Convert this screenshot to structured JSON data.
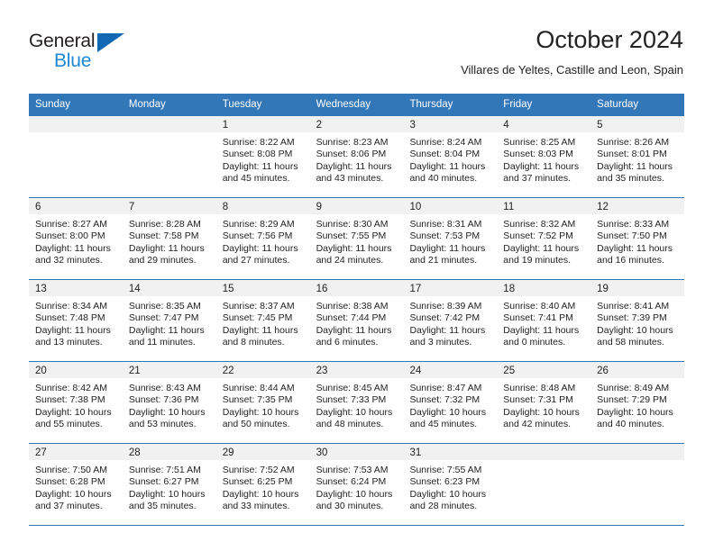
{
  "brand": {
    "name_part1": "General",
    "name_part2": "Blue",
    "triangle_color": "#1268b3",
    "blue_color": "#1b87d3"
  },
  "header": {
    "title": "October 2024",
    "subtitle": "Villares de Yeltes, Castille and Leon, Spain"
  },
  "theme": {
    "header_blue": "#3277b8",
    "daynum_band": "#f1f1f1",
    "text": "#222222"
  },
  "weekdays": [
    "Sunday",
    "Monday",
    "Tuesday",
    "Wednesday",
    "Thursday",
    "Friday",
    "Saturday"
  ],
  "weeks": [
    [
      {
        "day": "",
        "empty": true,
        "sunrise": "",
        "sunset": "",
        "daylight_line1": "",
        "daylight_line2": ""
      },
      {
        "day": "",
        "empty": true,
        "sunrise": "",
        "sunset": "",
        "daylight_line1": "",
        "daylight_line2": ""
      },
      {
        "day": "1",
        "sunrise": "Sunrise: 8:22 AM",
        "sunset": "Sunset: 8:08 PM",
        "daylight_line1": "Daylight: 11 hours",
        "daylight_line2": "and 45 minutes."
      },
      {
        "day": "2",
        "sunrise": "Sunrise: 8:23 AM",
        "sunset": "Sunset: 8:06 PM",
        "daylight_line1": "Daylight: 11 hours",
        "daylight_line2": "and 43 minutes."
      },
      {
        "day": "3",
        "sunrise": "Sunrise: 8:24 AM",
        "sunset": "Sunset: 8:04 PM",
        "daylight_line1": "Daylight: 11 hours",
        "daylight_line2": "and 40 minutes."
      },
      {
        "day": "4",
        "sunrise": "Sunrise: 8:25 AM",
        "sunset": "Sunset: 8:03 PM",
        "daylight_line1": "Daylight: 11 hours",
        "daylight_line2": "and 37 minutes."
      },
      {
        "day": "5",
        "sunrise": "Sunrise: 8:26 AM",
        "sunset": "Sunset: 8:01 PM",
        "daylight_line1": "Daylight: 11 hours",
        "daylight_line2": "and 35 minutes."
      }
    ],
    [
      {
        "day": "6",
        "sunrise": "Sunrise: 8:27 AM",
        "sunset": "Sunset: 8:00 PM",
        "daylight_line1": "Daylight: 11 hours",
        "daylight_line2": "and 32 minutes."
      },
      {
        "day": "7",
        "sunrise": "Sunrise: 8:28 AM",
        "sunset": "Sunset: 7:58 PM",
        "daylight_line1": "Daylight: 11 hours",
        "daylight_line2": "and 29 minutes."
      },
      {
        "day": "8",
        "sunrise": "Sunrise: 8:29 AM",
        "sunset": "Sunset: 7:56 PM",
        "daylight_line1": "Daylight: 11 hours",
        "daylight_line2": "and 27 minutes."
      },
      {
        "day": "9",
        "sunrise": "Sunrise: 8:30 AM",
        "sunset": "Sunset: 7:55 PM",
        "daylight_line1": "Daylight: 11 hours",
        "daylight_line2": "and 24 minutes."
      },
      {
        "day": "10",
        "sunrise": "Sunrise: 8:31 AM",
        "sunset": "Sunset: 7:53 PM",
        "daylight_line1": "Daylight: 11 hours",
        "daylight_line2": "and 21 minutes."
      },
      {
        "day": "11",
        "sunrise": "Sunrise: 8:32 AM",
        "sunset": "Sunset: 7:52 PM",
        "daylight_line1": "Daylight: 11 hours",
        "daylight_line2": "and 19 minutes."
      },
      {
        "day": "12",
        "sunrise": "Sunrise: 8:33 AM",
        "sunset": "Sunset: 7:50 PM",
        "daylight_line1": "Daylight: 11 hours",
        "daylight_line2": "and 16 minutes."
      }
    ],
    [
      {
        "day": "13",
        "sunrise": "Sunrise: 8:34 AM",
        "sunset": "Sunset: 7:48 PM",
        "daylight_line1": "Daylight: 11 hours",
        "daylight_line2": "and 13 minutes."
      },
      {
        "day": "14",
        "sunrise": "Sunrise: 8:35 AM",
        "sunset": "Sunset: 7:47 PM",
        "daylight_line1": "Daylight: 11 hours",
        "daylight_line2": "and 11 minutes."
      },
      {
        "day": "15",
        "sunrise": "Sunrise: 8:37 AM",
        "sunset": "Sunset: 7:45 PM",
        "daylight_line1": "Daylight: 11 hours",
        "daylight_line2": "and 8 minutes."
      },
      {
        "day": "16",
        "sunrise": "Sunrise: 8:38 AM",
        "sunset": "Sunset: 7:44 PM",
        "daylight_line1": "Daylight: 11 hours",
        "daylight_line2": "and 6 minutes."
      },
      {
        "day": "17",
        "sunrise": "Sunrise: 8:39 AM",
        "sunset": "Sunset: 7:42 PM",
        "daylight_line1": "Daylight: 11 hours",
        "daylight_line2": "and 3 minutes."
      },
      {
        "day": "18",
        "sunrise": "Sunrise: 8:40 AM",
        "sunset": "Sunset: 7:41 PM",
        "daylight_line1": "Daylight: 11 hours",
        "daylight_line2": "and 0 minutes."
      },
      {
        "day": "19",
        "sunrise": "Sunrise: 8:41 AM",
        "sunset": "Sunset: 7:39 PM",
        "daylight_line1": "Daylight: 10 hours",
        "daylight_line2": "and 58 minutes."
      }
    ],
    [
      {
        "day": "20",
        "sunrise": "Sunrise: 8:42 AM",
        "sunset": "Sunset: 7:38 PM",
        "daylight_line1": "Daylight: 10 hours",
        "daylight_line2": "and 55 minutes."
      },
      {
        "day": "21",
        "sunrise": "Sunrise: 8:43 AM",
        "sunset": "Sunset: 7:36 PM",
        "daylight_line1": "Daylight: 10 hours",
        "daylight_line2": "and 53 minutes."
      },
      {
        "day": "22",
        "sunrise": "Sunrise: 8:44 AM",
        "sunset": "Sunset: 7:35 PM",
        "daylight_line1": "Daylight: 10 hours",
        "daylight_line2": "and 50 minutes."
      },
      {
        "day": "23",
        "sunrise": "Sunrise: 8:45 AM",
        "sunset": "Sunset: 7:33 PM",
        "daylight_line1": "Daylight: 10 hours",
        "daylight_line2": "and 48 minutes."
      },
      {
        "day": "24",
        "sunrise": "Sunrise: 8:47 AM",
        "sunset": "Sunset: 7:32 PM",
        "daylight_line1": "Daylight: 10 hours",
        "daylight_line2": "and 45 minutes."
      },
      {
        "day": "25",
        "sunrise": "Sunrise: 8:48 AM",
        "sunset": "Sunset: 7:31 PM",
        "daylight_line1": "Daylight: 10 hours",
        "daylight_line2": "and 42 minutes."
      },
      {
        "day": "26",
        "sunrise": "Sunrise: 8:49 AM",
        "sunset": "Sunset: 7:29 PM",
        "daylight_line1": "Daylight: 10 hours",
        "daylight_line2": "and 40 minutes."
      }
    ],
    [
      {
        "day": "27",
        "sunrise": "Sunrise: 7:50 AM",
        "sunset": "Sunset: 6:28 PM",
        "daylight_line1": "Daylight: 10 hours",
        "daylight_line2": "and 37 minutes."
      },
      {
        "day": "28",
        "sunrise": "Sunrise: 7:51 AM",
        "sunset": "Sunset: 6:27 PM",
        "daylight_line1": "Daylight: 10 hours",
        "daylight_line2": "and 35 minutes."
      },
      {
        "day": "29",
        "sunrise": "Sunrise: 7:52 AM",
        "sunset": "Sunset: 6:25 PM",
        "daylight_line1": "Daylight: 10 hours",
        "daylight_line2": "and 33 minutes."
      },
      {
        "day": "30",
        "sunrise": "Sunrise: 7:53 AM",
        "sunset": "Sunset: 6:24 PM",
        "daylight_line1": "Daylight: 10 hours",
        "daylight_line2": "and 30 minutes."
      },
      {
        "day": "31",
        "sunrise": "Sunrise: 7:55 AM",
        "sunset": "Sunset: 6:23 PM",
        "daylight_line1": "Daylight: 10 hours",
        "daylight_line2": "and 28 minutes."
      },
      {
        "day": "",
        "empty": true,
        "sunrise": "",
        "sunset": "",
        "daylight_line1": "",
        "daylight_line2": ""
      },
      {
        "day": "",
        "empty": true,
        "sunrise": "",
        "sunset": "",
        "daylight_line1": "",
        "daylight_line2": ""
      }
    ]
  ]
}
